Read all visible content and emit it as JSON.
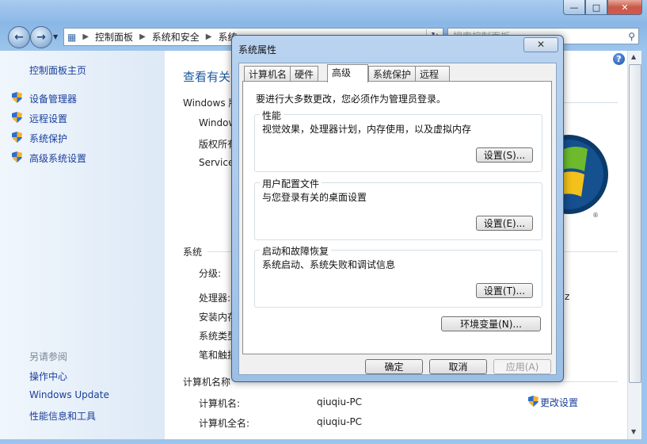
{
  "window": {
    "title_ghost": "",
    "minimize": "—",
    "maximize": "□",
    "close": "✕"
  },
  "address": {
    "crumbs": [
      "控制面板",
      "系统和安全",
      "系统"
    ],
    "search_placeholder": "搜索控制面板"
  },
  "sidebar": {
    "home": "控制面板主页",
    "items": [
      "设备管理器",
      "远程设置",
      "系统保护",
      "高级系统设置"
    ],
    "see_also": "另请参阅",
    "see_also_items": [
      "操作中心",
      "Windows Update",
      "性能信息和工具"
    ]
  },
  "main": {
    "title": "查看有关",
    "edition_header": "Windows 版",
    "edition_line": "Windows",
    "copyright": "版权所有",
    "service": "Service",
    "system_header": "系统",
    "rows": [
      "分级:",
      "处理器:",
      "安装内存",
      "系统类型",
      "笔和触摸"
    ],
    "cpu_suffix": "Hz",
    "computer_header": "计算机名称",
    "computer_name_label": "计算机名:",
    "computer_name_value": "qiuqiu-PC",
    "full_name_label": "计算机全名:",
    "full_name_value": "qiuqiu-PC",
    "change_settings": "更改设置"
  },
  "dialog": {
    "title": "系统属性",
    "close": "✕",
    "tabs": [
      "计算机名",
      "硬件",
      "高级",
      "系统保护",
      "远程"
    ],
    "active_tab": "高级",
    "admin_note": "要进行大多数更改，您必须作为管理员登录。",
    "groups": [
      {
        "title": "性能",
        "desc": "视觉效果，处理器计划，内存使用，以及虚拟内存",
        "button": "设置(S)..."
      },
      {
        "title": "用户配置文件",
        "desc": "与您登录有关的桌面设置",
        "button": "设置(E)..."
      },
      {
        "title": "启动和故障恢复",
        "desc": "系统启动、系统失败和调试信息",
        "button": "设置(T)..."
      }
    ],
    "env_button": "环境变量(N)...",
    "ok": "确定",
    "cancel": "取消",
    "apply": "应用(A)"
  },
  "colors": {
    "link": "#1a3e9b",
    "title_blue": "#1e5a9c",
    "see_also_gray": "#7a8699"
  }
}
